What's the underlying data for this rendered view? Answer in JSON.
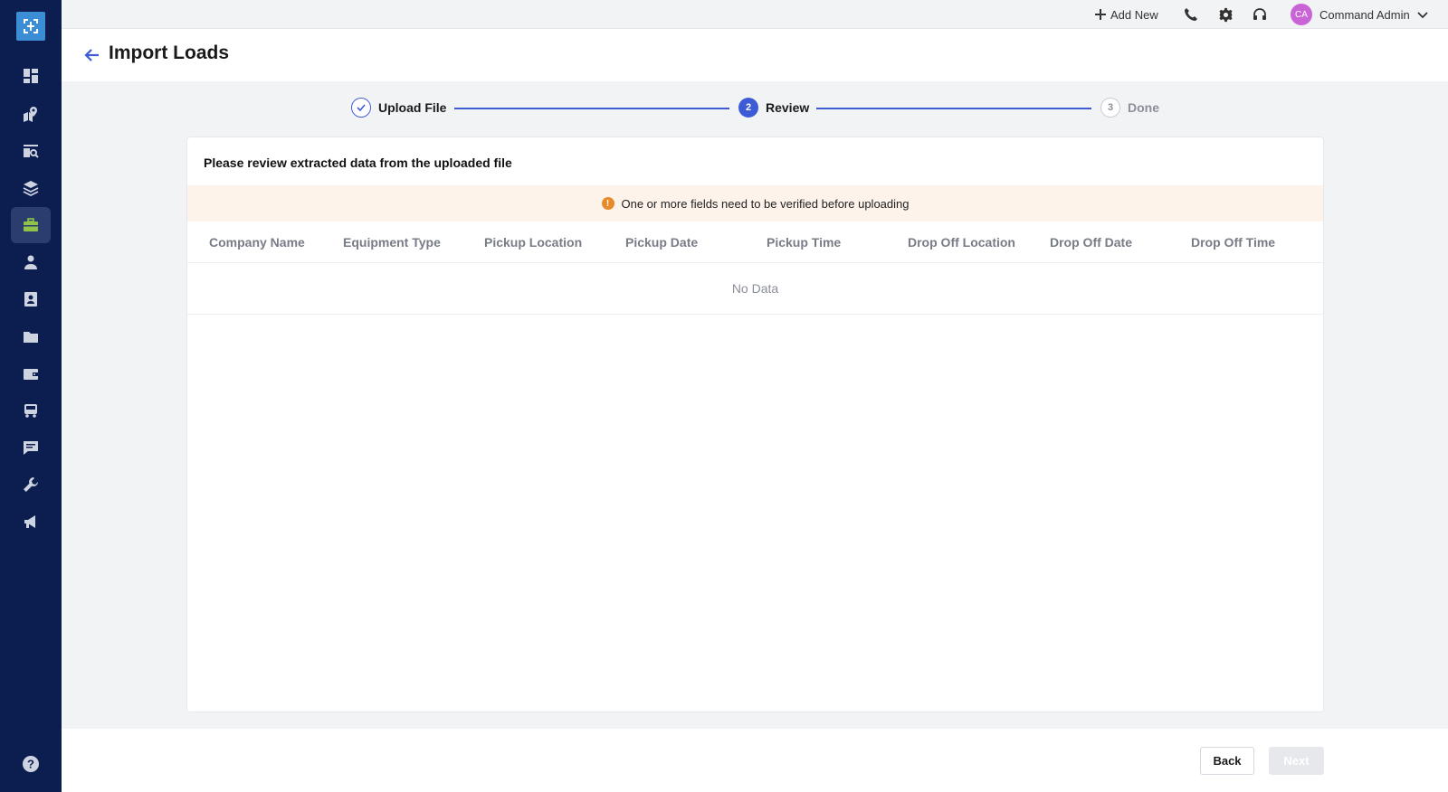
{
  "topbar": {
    "add_new_label": "Add New",
    "user_initials": "CA",
    "user_name": "Command Admin"
  },
  "page": {
    "title": "Import Loads"
  },
  "stepper": {
    "steps": [
      {
        "number": "",
        "label": "Upload File",
        "state": "done"
      },
      {
        "number": "2",
        "label": "Review",
        "state": "active"
      },
      {
        "number": "3",
        "label": "Done",
        "state": "todo"
      }
    ]
  },
  "card": {
    "title": "Please review extracted data from the uploaded file",
    "warning": "One or more fields need to be verified before uploading",
    "warning_icon": "!",
    "columns": [
      "Company Name",
      "Equipment Type",
      "Pickup Location",
      "Pickup Date",
      "Pickup Time",
      "Drop Off Location",
      "Drop Off Date",
      "Drop Off Time"
    ],
    "empty_text": "No Data"
  },
  "footer": {
    "back_label": "Back",
    "next_label": "Next"
  },
  "colors": {
    "sidebar": "#0c1e4f",
    "accent": "#3d5bd6",
    "active_nav_icon": "#8fc34a",
    "warning": "#e98a2a"
  },
  "sidebar": {
    "icons": [
      "dashboard-icon",
      "map-location-icon",
      "search-loads-icon",
      "layers-icon",
      "briefcase-icon",
      "driver-icon",
      "contacts-icon",
      "folder-icon",
      "wallet-icon",
      "truck-icon",
      "message-icon",
      "wrench-icon",
      "megaphone-icon"
    ],
    "active_index": 4
  }
}
